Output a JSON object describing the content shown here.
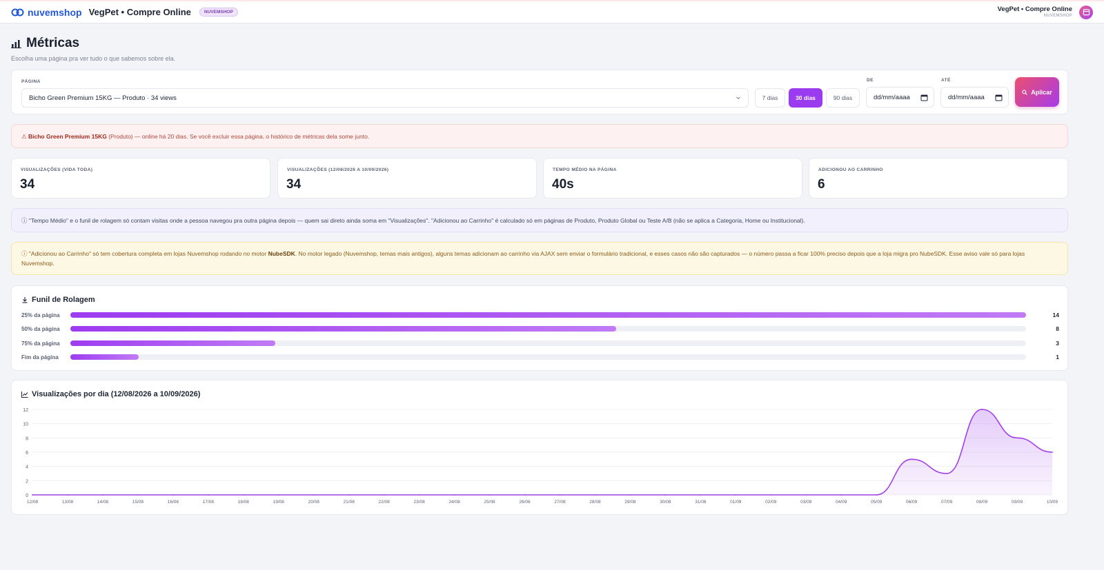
{
  "header": {
    "brand": "nuvemshop",
    "store_name": "VegPet • Compre Online",
    "platform_badge": "NUVEMSHOP",
    "user_name": "VegPet • Compre Online",
    "user_sub": "NUVEMSHOP"
  },
  "page": {
    "title": "Métricas",
    "subtitle": "Escolha uma página pra ver tudo o que sabemos sobre ela."
  },
  "filters": {
    "page_label": "PÁGINA",
    "page_selected": "Bicho Green Premium 15KG — Produto · 34 views",
    "ranges": [
      "7 dias",
      "30 dias",
      "90 dias"
    ],
    "active_range": "30 dias",
    "from_label": "DE",
    "to_label": "ATÉ",
    "from_value": "dd/mm/aaaa",
    "to_value": "dd/mm/aaaa",
    "apply_label": "Aplicar"
  },
  "alert_page": {
    "icon": "⚠",
    "name": "Bicho Green Premium 15KG",
    "text": " (Produto) — online há 20 dias. Se você excluir essa página, o histórico de métricas dela some junto."
  },
  "stats": [
    {
      "label": "VISUALIZAÇÕES (VIDA TODA)",
      "value": "34"
    },
    {
      "label": "VISUALIZAÇÕES (12/08/2026 A 10/09/2026)",
      "value": "34"
    },
    {
      "label": "TEMPO MÉDIO NA PÁGINA",
      "value": "40s"
    },
    {
      "label": "ADICIONOU AO CARRINHO",
      "value": "6"
    }
  ],
  "info_note": "ⓘ \"Tempo Médio\" e o funil de rolagem só contam visitas onde a pessoa navegou pra outra página depois — quem sai direto ainda soma em \"Visualizações\". \"Adicionou ao Carrinho\" é calculado só em páginas de Produto, Produto Global ou Teste A/B (não se aplica a Categoria, Home ou Institucional).",
  "warn_note": {
    "icon": "ⓘ",
    "before": " \"Adicionou ao Carrinho\" só tem cobertura completa em lojas Nuvemshop rodando no motor ",
    "bold": "NubeSDK",
    "after": ". No motor legado (Nuvemshop, temas mais antigos), alguns temas adicionam ao carrinho via AJAX sem enviar o formulário tradicional, e esses casos não são capturados — o número passa a ficar 100% preciso depois que a loja migra pro NubeSDK. Esse aviso vale só para lojas Nuvemshop."
  },
  "funnel": {
    "title": "Funil de Rolagem",
    "max": 14,
    "rows": [
      {
        "label": "25% da página",
        "count": 14
      },
      {
        "label": "50% da página",
        "count": 8
      },
      {
        "label": "75% da página",
        "count": 3
      },
      {
        "label": "Fim da página",
        "count": 1
      }
    ]
  },
  "colors": {
    "accent": "#9b3bf0",
    "brand_blue": "#2459d6",
    "danger_bg": "#fdf2f1",
    "warn_bg": "#fdf8e4",
    "info_bg": "#f2f0fd"
  },
  "chart_data": {
    "type": "area",
    "title": "Visualizações por dia (12/08/2026 a 10/09/2026)",
    "xlabel": "",
    "ylabel": "",
    "ylim": [
      0,
      12
    ],
    "yticks": [
      0,
      2,
      4,
      6,
      8,
      10,
      12
    ],
    "grid": true,
    "categories": [
      "12/08",
      "13/08",
      "14/08",
      "15/08",
      "16/08",
      "17/08",
      "18/08",
      "19/08",
      "20/08",
      "21/08",
      "22/08",
      "23/08",
      "24/08",
      "25/08",
      "26/08",
      "27/08",
      "28/08",
      "29/08",
      "30/08",
      "31/08",
      "01/09",
      "02/09",
      "03/09",
      "04/09",
      "05/09",
      "06/09",
      "07/09",
      "08/09",
      "09/09",
      "10/09"
    ],
    "values": [
      0,
      0,
      0,
      0,
      0,
      0,
      0,
      0,
      0,
      0,
      0,
      0,
      0,
      0,
      0,
      0,
      0,
      0,
      0,
      0,
      0,
      0,
      0,
      0,
      0,
      5,
      3,
      12,
      8,
      6
    ]
  }
}
